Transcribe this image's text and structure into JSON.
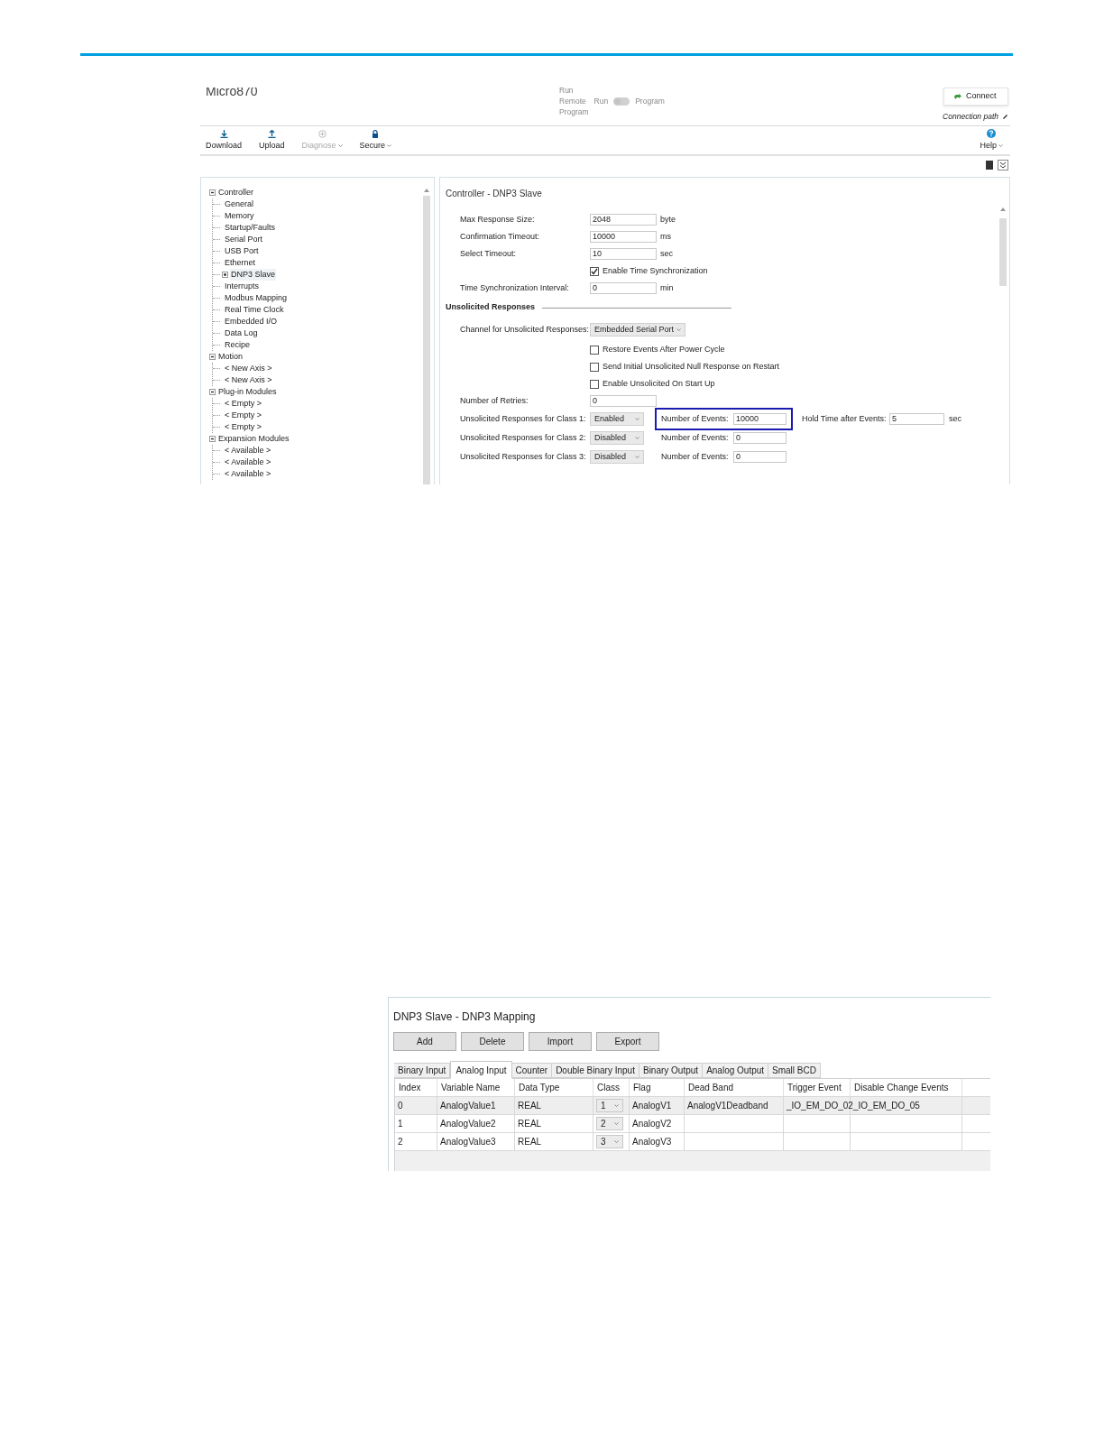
{
  "app_window": {
    "title": "Micro870",
    "mode_switch": {
      "labels_left": [
        "Run",
        "Remote",
        "Program"
      ],
      "label_run": "Run",
      "label_program": "Program",
      "on": false
    },
    "connect_button": "Connect",
    "connection_path": "Connection path",
    "toolbar": [
      {
        "label": "Download",
        "disabled": false,
        "menu": false
      },
      {
        "label": "Upload",
        "disabled": false,
        "menu": false
      },
      {
        "label": "Diagnose",
        "disabled": true,
        "menu": true
      },
      {
        "label": "Secure",
        "disabled": false,
        "menu": true
      }
    ],
    "help_button": "Help",
    "tree": [
      {
        "label": "Controller",
        "expanded": true,
        "selected": false,
        "children": [
          {
            "label": "General",
            "selected": false
          },
          {
            "label": "Memory",
            "selected": false
          },
          {
            "label": "Startup/Faults",
            "selected": false
          },
          {
            "label": "Serial Port",
            "selected": false
          },
          {
            "label": "USB Port",
            "selected": false
          },
          {
            "label": "Ethernet",
            "selected": false
          },
          {
            "label": "DNP3 Slave",
            "selected": true,
            "expanded": false
          },
          {
            "label": "Interrupts",
            "selected": false
          },
          {
            "label": "Modbus Mapping",
            "selected": false
          },
          {
            "label": "Real Time Clock",
            "selected": false
          },
          {
            "label": "Embedded I/O",
            "selected": false
          },
          {
            "label": "Data Log",
            "selected": false
          },
          {
            "label": "Recipe",
            "selected": false
          }
        ]
      },
      {
        "label": "Motion",
        "expanded": true,
        "selected": false,
        "children": [
          {
            "label": "< New Axis >",
            "selected": false
          },
          {
            "label": "< New Axis >",
            "selected": false
          }
        ]
      },
      {
        "label": "Plug-in Modules",
        "expanded": true,
        "selected": false,
        "children": [
          {
            "label": "< Empty >",
            "selected": false
          },
          {
            "label": "< Empty >",
            "selected": false
          },
          {
            "label": "< Empty >",
            "selected": false
          }
        ]
      },
      {
        "label": "Expansion Modules",
        "expanded": true,
        "selected": false,
        "children": [
          {
            "label": "< Available >",
            "selected": false
          },
          {
            "label": "< Available >",
            "selected": false
          },
          {
            "label": "< Available >",
            "selected": false
          }
        ]
      }
    ],
    "panel_title": "Controller - DNP3 Slave",
    "form": [
      {
        "kind": "input",
        "label": "Max Response Size:",
        "value": "2048",
        "unit": "byte"
      },
      {
        "kind": "input",
        "label": "Confirmation Timeout:",
        "value": "10000",
        "unit": "ms"
      },
      {
        "kind": "input",
        "label": "Select Timeout:",
        "value": "10",
        "unit": "sec"
      },
      {
        "kind": "checkbox",
        "label": "Enable Time Synchronization",
        "checked": true
      },
      {
        "kind": "input",
        "label": "Time Synchronization Interval:",
        "value": "0",
        "unit": "min"
      },
      {
        "kind": "section",
        "label": "Unsolicited Responses"
      },
      {
        "kind": "select",
        "label": "Channel for Unsolicited Responses:",
        "value": "Embedded Serial Port"
      },
      {
        "kind": "checkbox",
        "label": "Restore Events After Power Cycle",
        "checked": false
      },
      {
        "kind": "checkbox",
        "label": "Send Initial Unsolicited Null Response on Restart",
        "checked": false
      },
      {
        "kind": "checkbox",
        "label": "Enable Unsolicited On Start Up",
        "checked": false
      },
      {
        "kind": "input",
        "label": "Number of Retries:",
        "value": "0"
      },
      {
        "kind": "class",
        "label": "Unsolicited Responses for Class 1:",
        "value": "Enabled",
        "events_label": "Number of Events:",
        "events_value": "10000",
        "highlighted": true,
        "hold_label": "Hold Time after Events:",
        "hold_value": "5",
        "hold_unit": "sec"
      },
      {
        "kind": "class",
        "label": "Unsolicited Responses for Class 2:",
        "value": "Disabled",
        "events_label": "Number of Events:",
        "events_value": "0",
        "highlighted": false
      },
      {
        "kind": "class",
        "label": "Unsolicited Responses for Class 3:",
        "value": "Disabled",
        "events_label": "Number of Events:",
        "events_value": "0",
        "highlighted": false
      }
    ]
  },
  "mapping_window": {
    "title": "DNP3 Slave - DNP3 Mapping",
    "buttons": [
      "Add",
      "Delete",
      "Import",
      "Export"
    ],
    "tabs": [
      {
        "label": "Binary Input",
        "selected": false
      },
      {
        "label": "Analog Input",
        "selected": true
      },
      {
        "label": "Counter",
        "selected": false
      },
      {
        "label": "Double Binary Input",
        "selected": false
      },
      {
        "label": "Binary Output",
        "selected": false
      },
      {
        "label": "Analog Output",
        "selected": false
      },
      {
        "label": "Small BCD",
        "selected": false
      }
    ],
    "table": {
      "columns": [
        "Index",
        "Variable Name",
        "Data Type",
        "Class",
        "Flag",
        "Dead Band",
        "Trigger Event",
        "Disable Change Events"
      ],
      "rows": [
        {
          "selected": true,
          "cells": [
            "0",
            "AnalogValue1",
            "REAL",
            "1",
            "AnalogV1",
            "AnalogV1Deadband",
            "_IO_EM_DO_02",
            "_IO_EM_DO_05"
          ]
        },
        {
          "selected": false,
          "cells": [
            "1",
            "AnalogValue2",
            "REAL",
            "2",
            "AnalogV2",
            "",
            "",
            " "
          ]
        },
        {
          "selected": false,
          "cells": [
            "2",
            "AnalogValue3",
            "REAL",
            "3",
            "AnalogV3",
            "",
            "",
            ""
          ]
        }
      ]
    }
  }
}
